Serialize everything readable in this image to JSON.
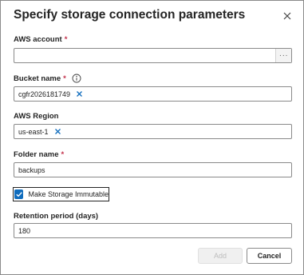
{
  "dialog": {
    "title": "Specify storage connection parameters",
    "close_icon": "close-icon"
  },
  "aws_account": {
    "label": "AWS account",
    "required_mark": "*",
    "value": "",
    "browse_label": "···"
  },
  "bucket_name": {
    "label": "Bucket name",
    "required_mark": "*",
    "info_icon": "info-icon",
    "value": "cgfr2026181749",
    "clear_icon": "clear-icon"
  },
  "aws_region": {
    "label": "AWS Region",
    "value": "us-east-1",
    "clear_icon": "clear-icon"
  },
  "folder_name": {
    "label": "Folder name",
    "required_mark": "*",
    "value": "backups"
  },
  "immutable": {
    "label": "Make Storage Immutable",
    "checked": true
  },
  "retention": {
    "label": "Retention period (days)",
    "value": "180"
  },
  "footer": {
    "add_label": "Add",
    "add_disabled": true,
    "cancel_label": "Cancel"
  },
  "colors": {
    "accent": "#0f6cbd",
    "required": "#c4314b",
    "text": "#242424",
    "border": "#8a8a8a"
  }
}
